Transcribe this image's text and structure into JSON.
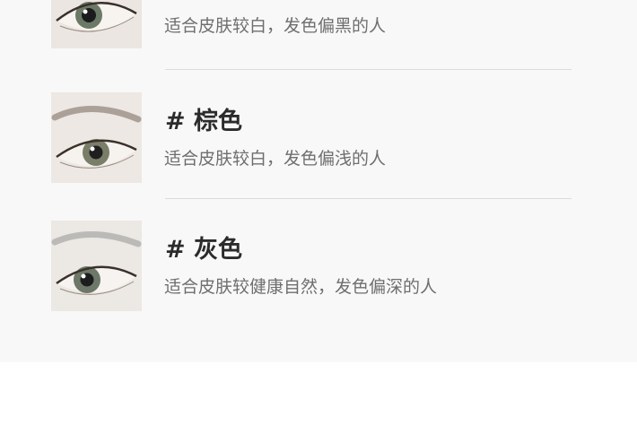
{
  "items": [
    {
      "title": "",
      "desc": "适合皮肤较白，发色偏黑的人",
      "image_alt": "eye-with-black-brow"
    },
    {
      "title": "# 棕色",
      "desc": "适合皮肤较白，发色偏浅的人",
      "image_alt": "eye-with-brown-brow"
    },
    {
      "title": "# 灰色",
      "desc": "适合皮肤较健康自然，发色偏深的人",
      "image_alt": "eye-with-gray-brow"
    }
  ],
  "colors": {
    "panel_bg": "#f8f8f8",
    "title": "#2b2b2b",
    "desc": "#6e6e6e",
    "divider": "#dcdcdc"
  }
}
